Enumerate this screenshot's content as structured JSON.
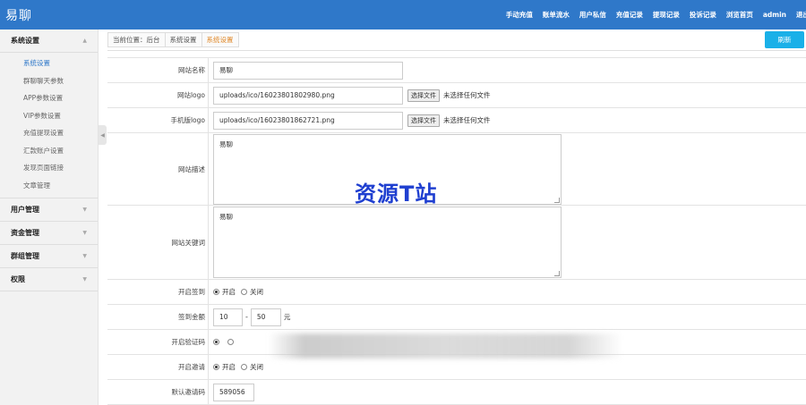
{
  "header": {
    "logo": "易聊",
    "nav": [
      "手动充值",
      "账单流水",
      "用户私信",
      "充值记录",
      "提现记录",
      "投诉记录",
      "浏览首页",
      "admin",
      "退出"
    ]
  },
  "sidebar": {
    "groups": [
      {
        "label": "系统设置",
        "expanded": true
      },
      {
        "label": "用户管理"
      },
      {
        "label": "资金管理"
      },
      {
        "label": "群组管理"
      },
      {
        "label": "权限"
      }
    ],
    "items": [
      "系统设置",
      "群聊聊天参数",
      "APP参数设置",
      "VIP参数设置",
      "充值提现设置",
      "汇款账户设置",
      "发现页面链接",
      "文章管理"
    ],
    "active_item": "系统设置"
  },
  "breadcrumb": [
    "当前位置：后台",
    "系统设置",
    "系统设置"
  ],
  "refresh_label": "刷新",
  "form": {
    "site_name": {
      "label": "网站名称",
      "value": "易聊"
    },
    "site_logo": {
      "label": "网站logo",
      "value": "uploads/ico/16023801802980.png",
      "button": "选择文件",
      "status": "未选择任何文件"
    },
    "mobile_logo": {
      "label": "手机版logo",
      "value": "uploads/ico/16023801862721.png",
      "button": "选择文件",
      "status": "未选择任何文件"
    },
    "site_desc": {
      "label": "网站描述",
      "value": "易聊"
    },
    "site_keywords": {
      "label": "网站关键词",
      "value": "易聊"
    },
    "signin": {
      "label": "开启签到",
      "on": "开启",
      "off": "关闭",
      "selected": "on"
    },
    "signin_amount": {
      "label": "签到金额",
      "min": "10",
      "sep": "-",
      "max": "50",
      "unit": "元"
    },
    "verify": {
      "label": "开启验证码"
    },
    "invite": {
      "label": "开启邀请",
      "on": "开启",
      "off": "关闭",
      "selected": "on"
    },
    "default_invite": {
      "label": "默认邀请码",
      "value": "589056"
    }
  },
  "watermark": "资源T站",
  "colors": {
    "header": "#2f78c9",
    "refresh": "#1ab0e8",
    "active": "#2f78c9",
    "crumb_current": "#e08a2c",
    "watermark": "#1f3fd0"
  }
}
